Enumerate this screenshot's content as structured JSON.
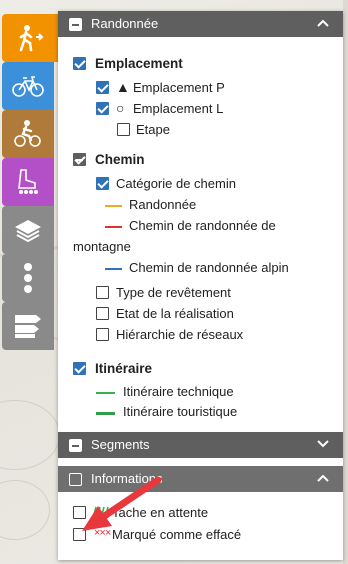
{
  "toolbar": [
    {
      "icon": "hiker-icon",
      "color": "#f39200"
    },
    {
      "icon": "bicycle-icon",
      "color": "#3c8fd9"
    },
    {
      "icon": "mountain-bike-icon",
      "color": "#b07a3a"
    },
    {
      "icon": "inline-skate-icon",
      "color": "#b34fc7"
    },
    {
      "icon": "layers-icon",
      "color": "#8a8a8a"
    },
    {
      "icon": "more-vertical-icon",
      "color": "#8a8a8a"
    },
    {
      "icon": "signpost-icon",
      "color": "#8a8a8a"
    }
  ],
  "panel": {
    "randonnee": {
      "title": "Randonnée"
    },
    "emplacement": {
      "label": "Emplacement",
      "p_symbol": "▲",
      "p_label": "Emplacement P",
      "l_symbol": "○",
      "l_label": "Emplacement L",
      "etape_label": "Etape"
    },
    "chemin": {
      "label": "Chemin",
      "categorie_label": "Catégorie de chemin",
      "legend": [
        {
          "label": "Randonnée",
          "color": "#f5a623"
        },
        {
          "label_line1": "Chemin de randonnée de",
          "label_line2": "montagne",
          "color": "#e03131"
        },
        {
          "label": "Chemin de randonnée alpin",
          "color": "#2f72b8"
        }
      ],
      "type_label": "Type de revêtement",
      "etat_label": "Etat de la réalisation",
      "hierarchie_label": "Hiérarchie de réseaux"
    },
    "itineraire": {
      "label": "Itinéraire",
      "legend": [
        {
          "label": "Itinéraire technique",
          "color": "#37b24d"
        },
        {
          "label": "Itinéraire touristique",
          "color": "#2f9e44"
        }
      ]
    },
    "segments": {
      "title": "Segments"
    },
    "informations": {
      "title": "Informations",
      "tache_label": "Tache en attente",
      "marque_symbol": "×××",
      "marque_label": "Marqué comme effacé"
    }
  },
  "annotation": {
    "arrow_color": "#e8383d"
  }
}
